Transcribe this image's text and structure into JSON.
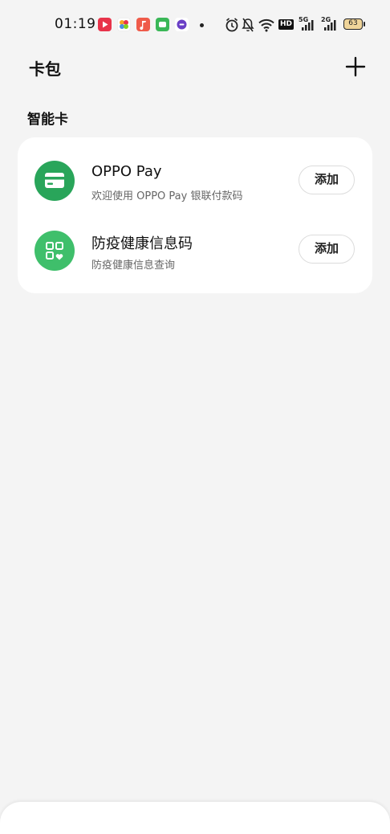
{
  "status_bar": {
    "time": "01:19",
    "battery": "63",
    "signal_1": "5G",
    "signal_2": "2G",
    "hd_label": "HD"
  },
  "header": {
    "title": "卡包"
  },
  "section": {
    "title": "智能卡"
  },
  "cards": [
    {
      "title": "OPPO Pay",
      "subtitle": "欢迎使用 OPPO Pay 银联付款码",
      "button": "添加",
      "icon": "credit-card-icon"
    },
    {
      "title": "防疫健康信息码",
      "subtitle": "防疫健康信息查询",
      "button": "添加",
      "icon": "health-qr-icon"
    }
  ],
  "colors": {
    "background": "#f4f4f4",
    "card_bg": "#ffffff",
    "icon_green": "#29a55a",
    "icon_green_light": "#3fbf6b"
  }
}
